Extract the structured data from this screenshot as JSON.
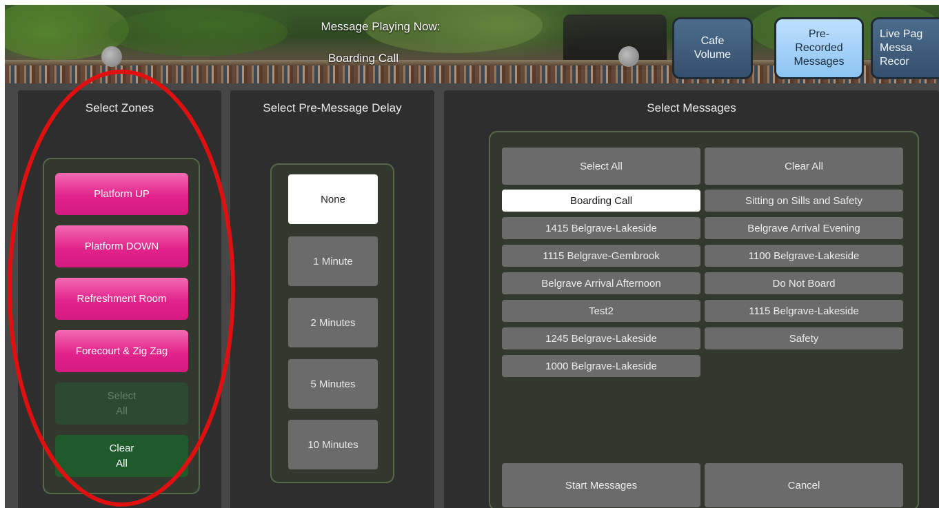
{
  "header": {
    "now_playing_label": "Message Playing Now:",
    "now_playing_value": "Boarding Call",
    "tabs": [
      {
        "label": "Cafe\nVolume",
        "active": false
      },
      {
        "label": "Pre-\nRecorded\nMessages",
        "active": true
      },
      {
        "label": "Live Pag\nMessa\nRecor",
        "active": false
      }
    ]
  },
  "zones": {
    "title": "Select Zones",
    "items": [
      {
        "label": "Platform UP"
      },
      {
        "label": "Platform DOWN"
      },
      {
        "label": "Refreshment Room"
      },
      {
        "label": "Forecourt & Zig Zag"
      }
    ],
    "select_all": "Select\nAll",
    "clear_all": "Clear\nAll"
  },
  "delay": {
    "title": "Select Pre-Message Delay",
    "options": [
      {
        "label": "None",
        "selected": true
      },
      {
        "label": "1 Minute",
        "selected": false
      },
      {
        "label": "2 Minutes",
        "selected": false
      },
      {
        "label": "5 Minutes",
        "selected": false
      },
      {
        "label": "10 Minutes",
        "selected": false
      }
    ]
  },
  "messages": {
    "title": "Select Messages",
    "select_all": "Select All",
    "clear_all": "Clear All",
    "left": [
      {
        "label": "Boarding Call",
        "selected": true
      },
      {
        "label": "1415 Belgrave-Lakeside",
        "selected": false
      },
      {
        "label": "1115 Belgrave-Gembrook",
        "selected": false
      },
      {
        "label": "Belgrave Arrival Afternoon",
        "selected": false
      },
      {
        "label": "Test2",
        "selected": false
      },
      {
        "label": "1245 Belgrave-Lakeside",
        "selected": false
      },
      {
        "label": "1000 Belgrave-Lakeside",
        "selected": false
      }
    ],
    "right": [
      {
        "label": "Sitting on Sills and Safety",
        "selected": false
      },
      {
        "label": "Belgrave Arrival Evening",
        "selected": false
      },
      {
        "label": "1100 Belgrave-Lakeside",
        "selected": false
      },
      {
        "label": "Do Not Board",
        "selected": false
      },
      {
        "label": "1115 Belgrave-Lakeside",
        "selected": false
      },
      {
        "label": "Safety",
        "selected": false
      }
    ],
    "start": "Start Messages",
    "cancel": "Cancel"
  },
  "colors": {
    "zone_button": "#e2238b",
    "annotation_ring": "#e01010",
    "selected_button": "#ffffff",
    "tab_active": "#8cc4f2"
  }
}
